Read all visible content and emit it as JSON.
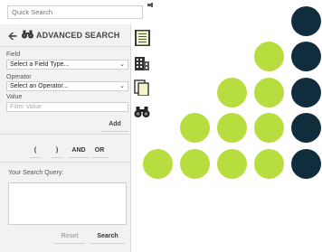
{
  "quick_search": {
    "placeholder": "Quick Search"
  },
  "panel": {
    "title": "ADVANCED SEARCH",
    "field_label": "Field",
    "field_value": "Select a Field Type...",
    "operator_label": "Operator",
    "operator_value": "Select an Operator...",
    "value_label": "Value",
    "value_placeholder": "Filter Value",
    "add_label": "Add",
    "operators": [
      "(",
      ")",
      "AND",
      "OR"
    ],
    "query_label": "Your Search Query:",
    "reset_label": "Reset",
    "search_label": "Search"
  },
  "toolbar": {
    "icons": [
      "notebook-icon",
      "building-icon",
      "documents-icon",
      "binoculars-icon"
    ]
  },
  "decor": {
    "lime": "#b7dd3e",
    "navy": "#0f2d3d",
    "panel_bg": "#f2f2f2"
  }
}
